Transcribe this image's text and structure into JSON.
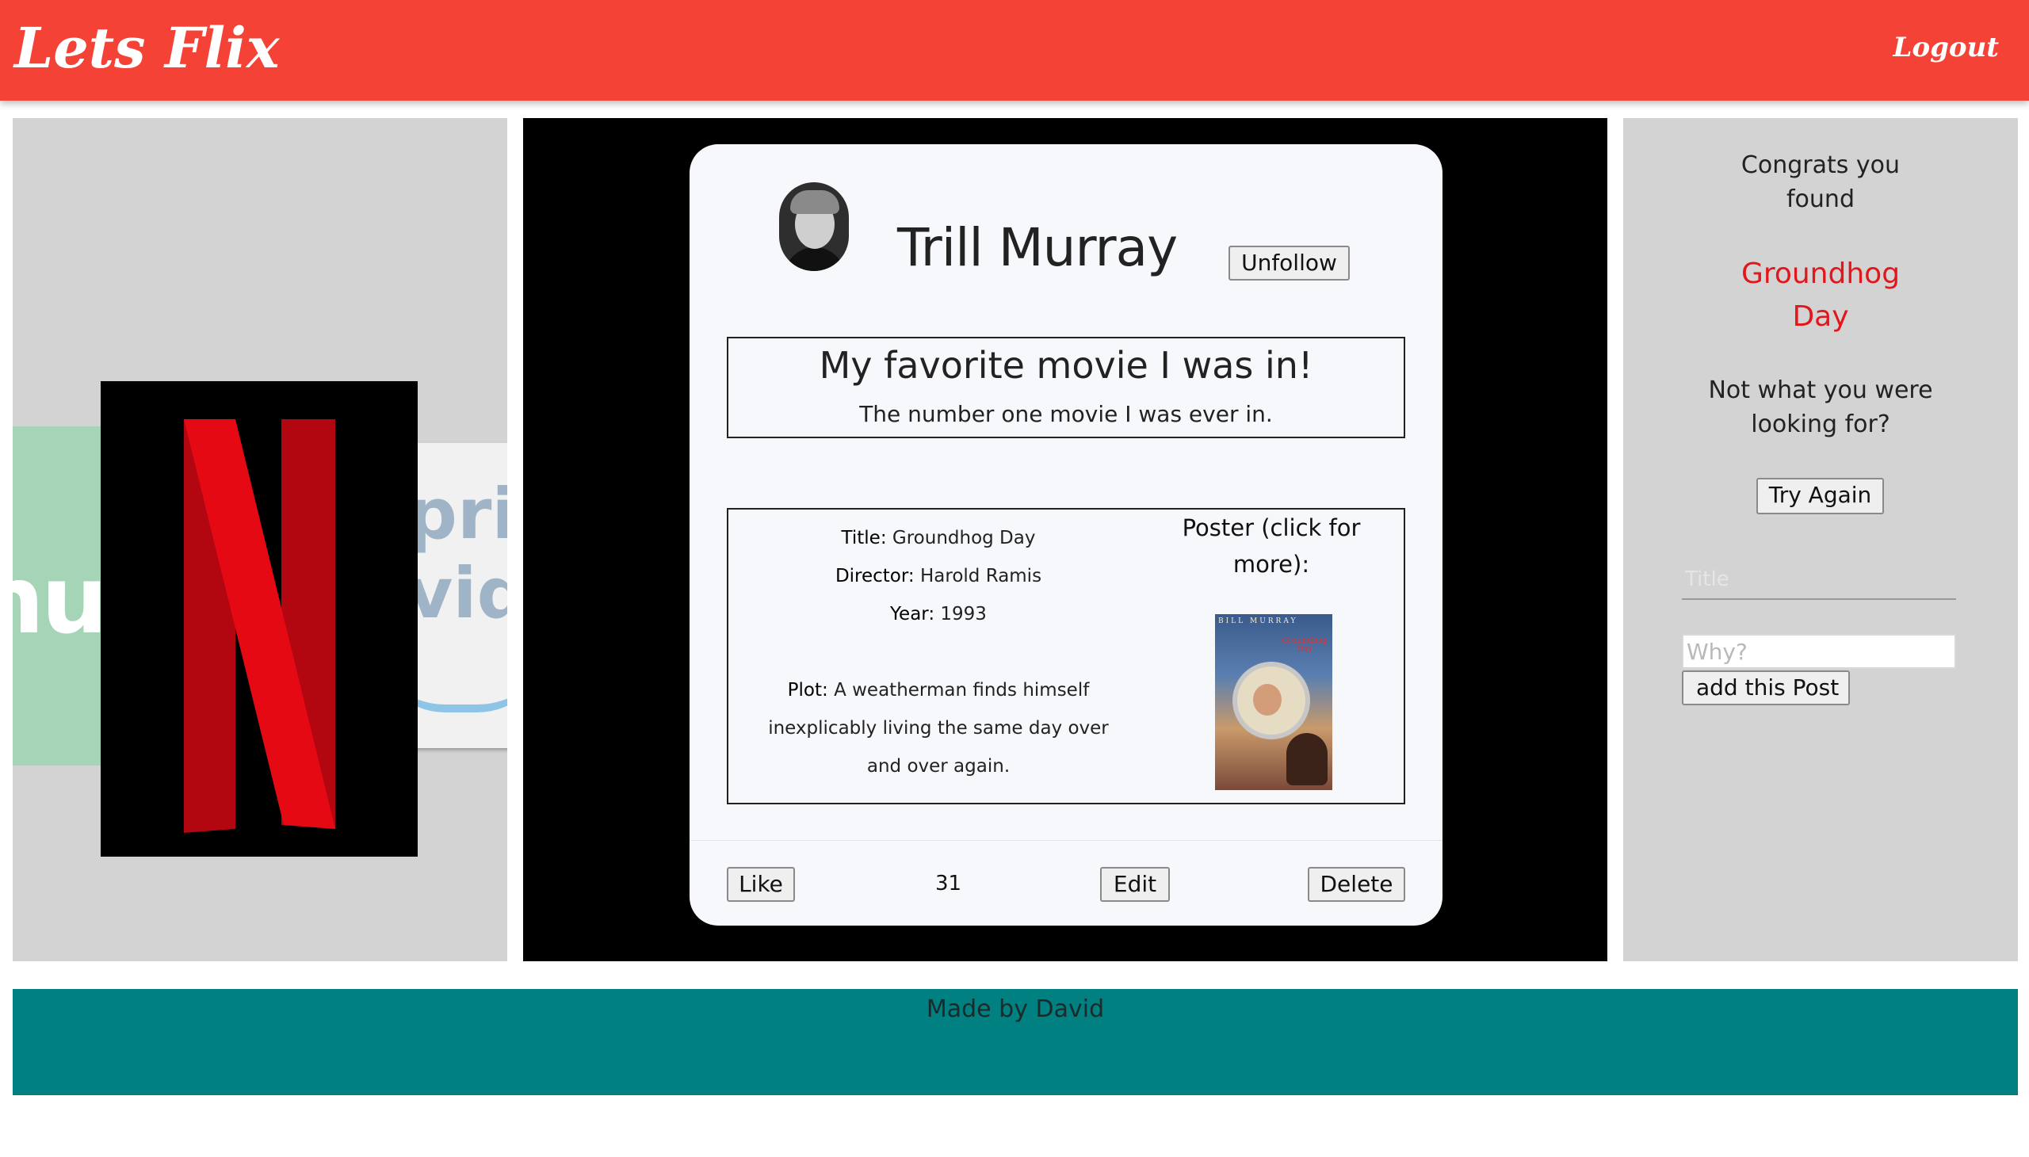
{
  "header": {
    "brand": "Lets Flix",
    "logout": "Logout",
    "color": "#f44336"
  },
  "streaming_logos": {
    "left": "hulu",
    "center": "netflix",
    "right": "prime video"
  },
  "post_card": {
    "user_name": "Trill Murray",
    "follow_button": "Unfollow",
    "post_title": "My favorite movie I was in!",
    "post_body": "The number one movie I was ever in.",
    "movie": {
      "title_label": "Title:",
      "title": "Groundhog Day",
      "director_label": "Director:",
      "director": "Harold Ramis",
      "year_label": "Year:",
      "year": "1993",
      "plot_label": "Plot:",
      "plot": "A weatherman finds himself inexplicably living the same day over and over again."
    },
    "poster_label": "Poster (click for more):",
    "poster_text": {
      "top": "BILL MURRAY",
      "title": "Groundhog Day"
    },
    "like_button": "Like",
    "like_count": "31",
    "edit_button": "Edit",
    "delete_button": "Delete"
  },
  "sidebar": {
    "congrats": "Congrats you found",
    "found_movie": "Groundhog Day",
    "not_what": "Not what you were looking for?",
    "try_again_button": "Try Again",
    "title_placeholder": "Title",
    "why_placeholder": "Why?",
    "add_post_button": "add this Post",
    "accent_color": "#e3161b"
  },
  "footer": {
    "text": "Made by David",
    "color": "#008080"
  }
}
